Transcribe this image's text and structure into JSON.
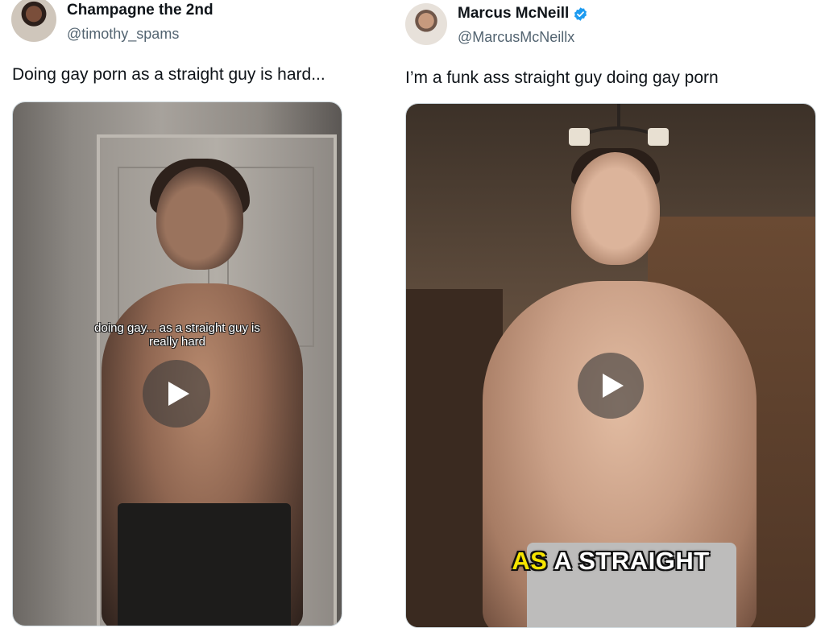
{
  "tweets": [
    {
      "display_name": "Champagne the 2nd",
      "handle": "@timothy_spams",
      "verified": false,
      "text": "Doing gay porn as a straight guy is hard...",
      "video": {
        "caption_line1": "doing gay... as a straight guy is",
        "caption_line2": "really hard",
        "play_icon": "play-icon"
      }
    },
    {
      "display_name": "Marcus McNeill",
      "handle": "@MarcusMcNeillx",
      "verified": true,
      "text": "I’m a funk ass straight guy doing gay porn",
      "video": {
        "caption_highlight": "AS",
        "caption_rest": "A STRAIGHT",
        "play_icon": "play-icon"
      }
    }
  ],
  "colors": {
    "text_primary": "#0f1419",
    "text_secondary": "#536471",
    "verified_blue": "#1d9bf0",
    "caption_yellow": "#f6e400"
  }
}
